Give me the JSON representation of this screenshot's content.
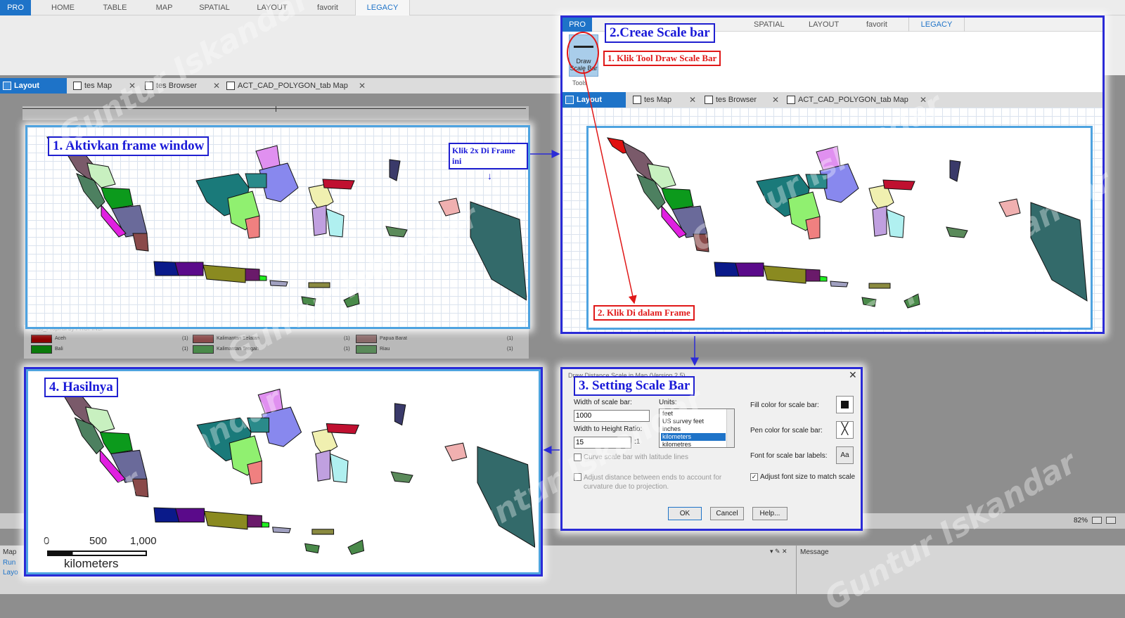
{
  "ribbon": {
    "tabs": [
      "PRO",
      "HOME",
      "TABLE",
      "MAP",
      "SPATIAL",
      "LAYOUT",
      "favorit",
      "LEGACY"
    ]
  },
  "doc_tabs": {
    "items": [
      "Layout",
      "tes Map",
      "tes Browser",
      "ACT_CAD_POLYGON_tab Map"
    ]
  },
  "ribbon_tool": {
    "label": "Draw Scale Bar",
    "group": "Tools"
  },
  "callouts": {
    "step1": "1. Aktivkan frame window",
    "step2": "2.Creae Scale bar",
    "step2a": "1. Klik Tool Draw Scale Bar",
    "step2b": "2. Klik Di dalam Frame",
    "step3": "3. Setting Scale Bar",
    "step4": "4. Hasilnya",
    "dblclick": "Klik 2x Di Frame ini"
  },
  "legend": {
    "title": "Indo_Propinsi by PROPINSI",
    "items": [
      {
        "name": "Aceh",
        "count": "(1)",
        "color": "#8b0000"
      },
      {
        "name": "Bali",
        "count": "(1)",
        "color": "#0a7a0a"
      },
      {
        "name": "Kalimantan Selatan",
        "count": "(1)",
        "color": "#8a4a4a"
      },
      {
        "name": "Kalimantan Tengah",
        "count": "(1)",
        "color": "#4a8a4a"
      },
      {
        "name": "Papua Barat",
        "count": "(1)",
        "color": "#8a6a6a"
      },
      {
        "name": "Riau",
        "count": "(1)",
        "color": "#5a8a5a"
      }
    ]
  },
  "dialog": {
    "title": "Draw Distance Scale in Map (Version 2.5)",
    "width_label": "Width of scale bar:",
    "width_value": "1000",
    "ratio_label": "Width to Height Ratio:",
    "ratio_value": "15",
    "ratio_suffix": ":1",
    "units_label": "Units:",
    "units": [
      "feet",
      "US survey feet",
      "inches",
      "kilometers",
      "kilometres"
    ],
    "units_selected": "kilometers",
    "curve_label": "Curve scale bar with latitude lines",
    "adjust_label": "Adjust distance between ends to account for curvature due to projection.",
    "fill_label": "Fill color for scale bar:",
    "pen_label": "Pen color for scale bar:",
    "font_label": "Font for scale bar labels:",
    "font_btn": "Aa",
    "adjust_font_label": "Adjust font size to match scale",
    "ok": "OK",
    "cancel": "Cancel",
    "help": "Help..."
  },
  "scalebar": {
    "ticks": [
      "0",
      "500",
      "1,000"
    ],
    "unit": "kilometers"
  },
  "statusbar": {
    "zoom": "82%",
    "message_label": "Message",
    "left_lines": [
      "Map",
      "Run",
      "Layo"
    ]
  },
  "watermark": "Guntur Iskandar",
  "colors": {
    "accent": "#1e73c8",
    "callout_blue": "#2020d0",
    "callout_red": "#e01818"
  }
}
